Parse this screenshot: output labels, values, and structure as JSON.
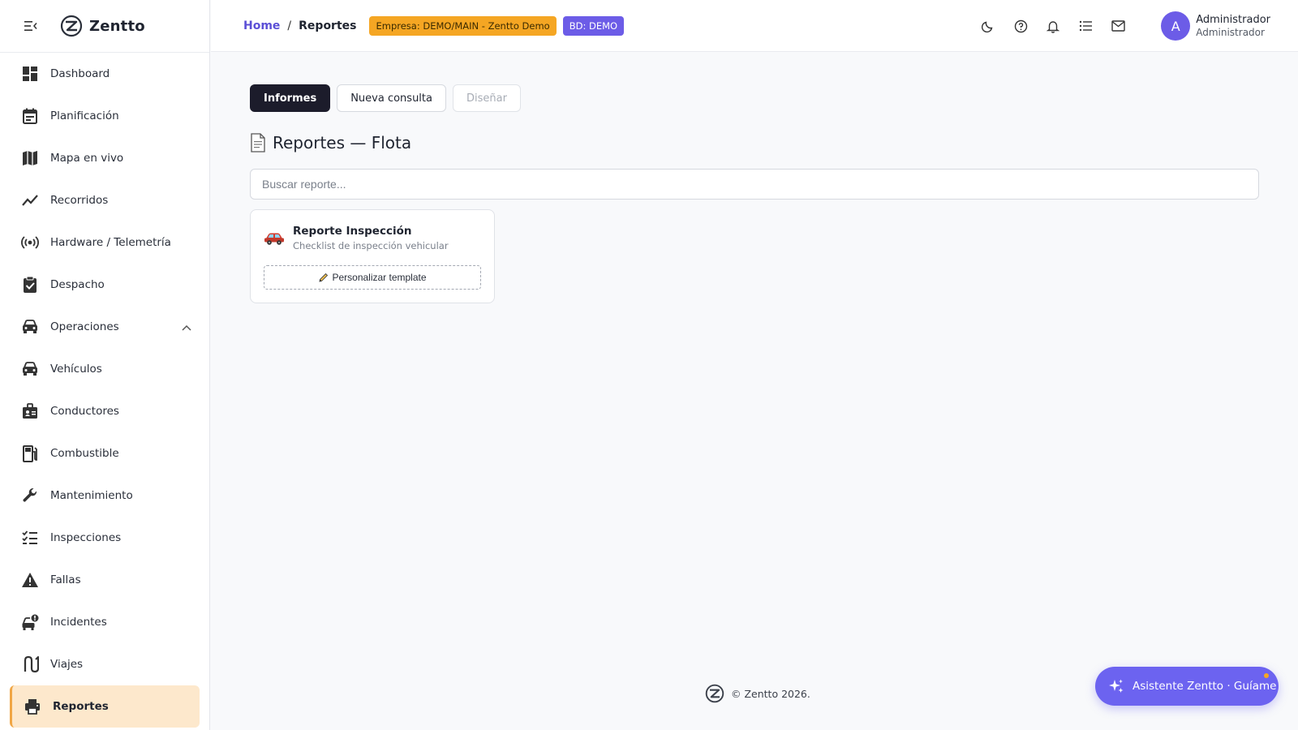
{
  "app": {
    "name": "Zentto"
  },
  "sidebar": {
    "items": [
      {
        "label": "Dashboard",
        "icon": "dashboard-icon",
        "name": "dashboard"
      },
      {
        "label": "Planificación",
        "icon": "calendar-icon",
        "name": "planificacion"
      },
      {
        "label": "Mapa en vivo",
        "icon": "map-icon",
        "name": "mapa-en-vivo"
      },
      {
        "label": "Recorridos",
        "icon": "trend-line-icon",
        "name": "recorridos"
      },
      {
        "label": "Hardware / Telemetría",
        "icon": "broadcast-icon",
        "name": "hardware-telemetria"
      },
      {
        "label": "Despacho",
        "icon": "clipboard-check-icon",
        "name": "despacho"
      },
      {
        "label": "Operaciones",
        "icon": "car-icon",
        "name": "operaciones",
        "expanded": true
      },
      {
        "label": "Vehículos",
        "icon": "car-icon",
        "name": "vehiculos"
      },
      {
        "label": "Conductores",
        "icon": "id-badge-icon",
        "name": "conductores"
      },
      {
        "label": "Combustible",
        "icon": "fuel-pump-icon",
        "name": "combustible"
      },
      {
        "label": "Mantenimiento",
        "icon": "wrench-icon",
        "name": "mantenimiento"
      },
      {
        "label": "Inspecciones",
        "icon": "checklist-icon",
        "name": "inspecciones"
      },
      {
        "label": "Fallas",
        "icon": "warning-icon",
        "name": "fallas"
      },
      {
        "label": "Incidentes",
        "icon": "car-alert-icon",
        "name": "incidentes"
      },
      {
        "label": "Viajes",
        "icon": "route-icon",
        "name": "viajes"
      },
      {
        "label": "Reportes",
        "icon": "printer-icon",
        "name": "reportes",
        "active": true
      }
    ]
  },
  "header": {
    "breadcrumb": {
      "home": "Home",
      "separator": "/",
      "current": "Reportes"
    },
    "company_badge": "Empresa: DEMO/MAIN - Zentto Demo",
    "db_badge": "BD: DEMO",
    "icons": [
      "moon-icon",
      "help-icon",
      "bell-icon",
      "list-icon",
      "mail-icon"
    ],
    "user": {
      "initial": "A",
      "name": "Administrador",
      "role": "Administrador"
    }
  },
  "main": {
    "tabs": [
      {
        "label": "Informes",
        "state": "active"
      },
      {
        "label": "Nueva consulta",
        "state": "normal"
      },
      {
        "label": "Diseñar",
        "state": "disabled"
      }
    ],
    "title": "Reportes — Flota",
    "search": {
      "placeholder": "Buscar reporte...",
      "value": ""
    },
    "cards": [
      {
        "title": "Reporte Inspección",
        "description": "Checklist de inspección vehicular",
        "icon": "car-icon",
        "button_label": "Personalizar template"
      }
    ]
  },
  "footer": {
    "text": "© Zentto 2026."
  },
  "assistant": {
    "label": "Asistente Zentto · Guíame"
  },
  "colors": {
    "accent": "#6c5ce7",
    "active_nav_bg": "#fde8cc",
    "company_badge": "#f5a623",
    "dark_tab": "#1c1c2b"
  }
}
